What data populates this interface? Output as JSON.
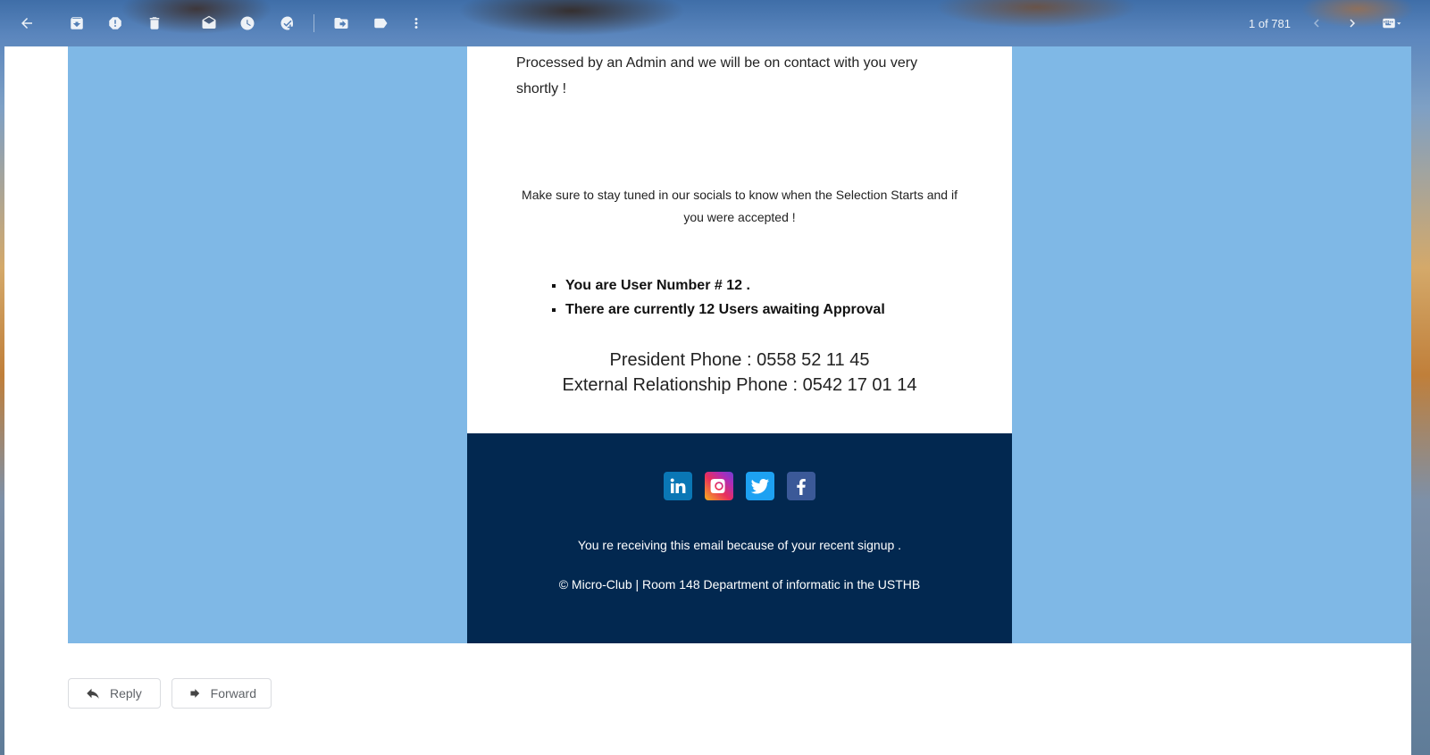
{
  "toolbar": {
    "counter": "1 of 781",
    "icons": [
      "back-arrow-icon",
      "archive-icon",
      "report-spam-icon",
      "delete-icon",
      "mark-unread-icon",
      "snooze-icon",
      "add-task-icon",
      "move-to-icon",
      "labels-icon",
      "more-vert-icon",
      "older-chevron-icon",
      "newer-chevron-icon",
      "keyboard-icon"
    ]
  },
  "email": {
    "body_text": "Processed by an Admin and we will be on contact with you very shortly !",
    "notice": "Make sure to stay tuned in our socials to know when the Selection Starts and if you were accepted !",
    "list": [
      "You are User Number # 12 .",
      "There are currently 12 Users awaiting Approval"
    ],
    "phones": {
      "president": "President Phone : 0558 52 11 45",
      "external": "External Relationship Phone : 0542 17 01 14"
    },
    "footer": {
      "note": "You re receiving this email because of your recent signup .",
      "copyright": "© Micro-Club |  Room 148 Department of informatic in the USTHB"
    },
    "socials": [
      "LinkedIn",
      "Instagram",
      "Twitter",
      "Facebook"
    ],
    "colors": {
      "outer_blue": "#7fb8e6",
      "footer_navy": "#022850"
    }
  },
  "actions": {
    "reply": "Reply",
    "forward": "Forward"
  }
}
